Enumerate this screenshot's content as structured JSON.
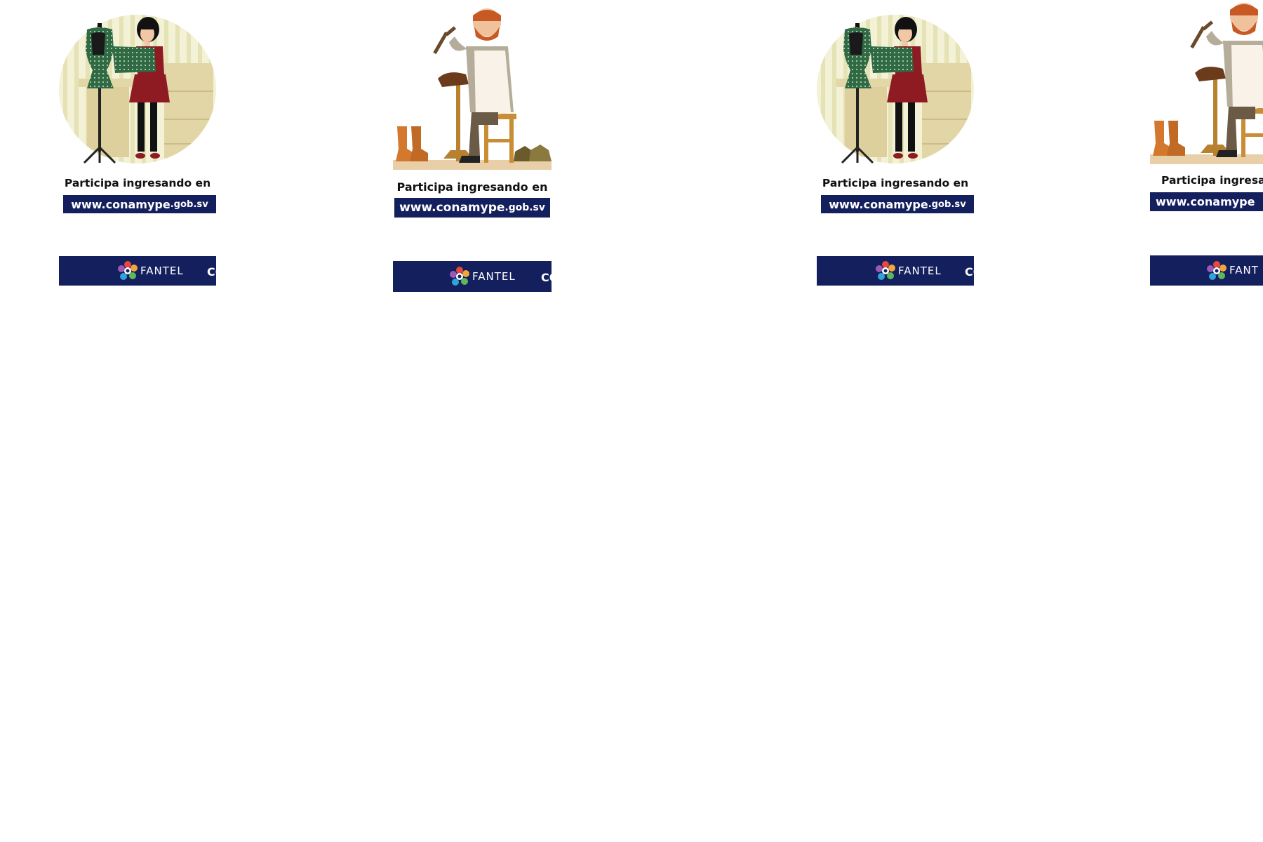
{
  "banners": [
    {
      "illustration": "seamstress-with-mannequin-illustration",
      "cta_text": "Participa ingresando en",
      "url_main": "www.conamype",
      "url_tld": ".gob.sv",
      "fantel_label": "FANTEL",
      "partner_label": "CO"
    },
    {
      "illustration": "shoemaker-with-hammer-illustration",
      "cta_text": "Participa ingresando en",
      "url_main": "www.conamype",
      "url_tld": ".gob.sv",
      "fantel_label": "FANTEL",
      "partner_label": "CO"
    },
    {
      "illustration": "seamstress-with-mannequin-illustration",
      "cta_text": "Participa ingresando en",
      "url_main": "www.conamype",
      "url_tld": ".gob.sv",
      "fantel_label": "FANTEL",
      "partner_label": "CO"
    },
    {
      "illustration": "shoemaker-with-hammer-illustration",
      "cta_text": "Participa ingresan",
      "url_main": "www.conamype",
      "url_tld": "",
      "fantel_label": "FANT",
      "partner_label": ""
    }
  ],
  "colors": {
    "brand_navy": "#141f5e",
    "text_dark": "#111111",
    "background": "#ffffff"
  }
}
